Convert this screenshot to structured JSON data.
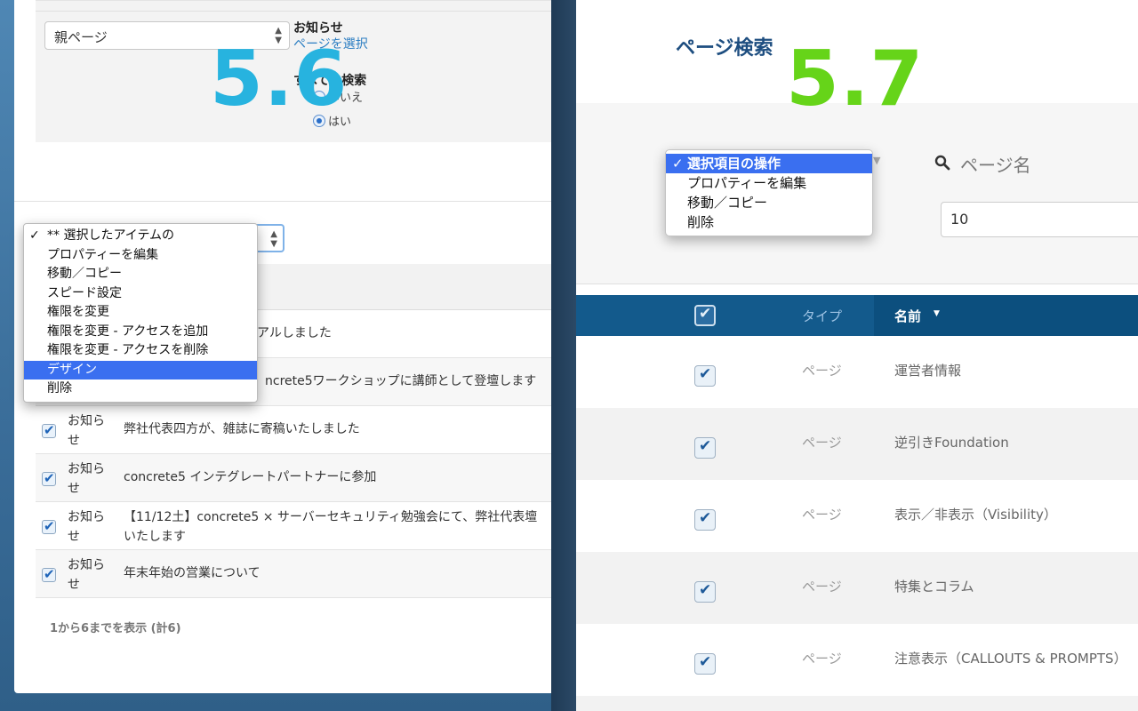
{
  "left": {
    "version_label": "5.6",
    "parent_select": {
      "value": "親ページ"
    },
    "notice_filter": {
      "title": "お知らせ",
      "select_link": "ページを選択"
    },
    "search_all": {
      "label": "すべてを検索",
      "option_no": "いいえ",
      "option_yes": "はい"
    },
    "bulk_menu": {
      "items": [
        {
          "label": "** 選択したアイテムの",
          "checked": true,
          "active": false
        },
        {
          "label": "プロパティーを編集",
          "checked": false,
          "active": false
        },
        {
          "label": "移動／コピー",
          "checked": false,
          "active": false
        },
        {
          "label": "スピード設定",
          "checked": false,
          "active": false
        },
        {
          "label": "権限を変更",
          "checked": false,
          "active": false
        },
        {
          "label": "権限を変更 - アクセスを追加",
          "checked": false,
          "active": false
        },
        {
          "label": "権限を変更 - アクセスを削除",
          "checked": false,
          "active": false
        },
        {
          "label": "デザイン",
          "checked": false,
          "active": true
        },
        {
          "label": "削除",
          "checked": false,
          "active": false
        }
      ]
    },
    "rows_partial": [
      {
        "name_tail": "アルしました"
      },
      {
        "name_tail": "ncrete5ワークショップに講師として登壇します"
      }
    ],
    "rows": [
      {
        "type": "お知らせ",
        "name": "弊社代表四方が、雑誌に寄稿いたしました"
      },
      {
        "type": "お知らせ",
        "name": "concrete5 インテグレートパートナーに参加"
      },
      {
        "type": "お知らせ",
        "name": "【11/12土】concrete5 × サーバーセキュリティ勉強会にて、弊社代表壇いたします"
      },
      {
        "type": "お知らせ",
        "name": "年末年始の営業について"
      }
    ],
    "footer": "1から6までを表示 (計6)"
  },
  "right": {
    "version_label": "5.7",
    "title": "ページ検索",
    "bulk_menu": {
      "items": [
        {
          "label": "選択項目の操作",
          "checked": true,
          "active": true
        },
        {
          "label": "プロパティーを編集",
          "checked": false,
          "active": false
        },
        {
          "label": "移動／コピー",
          "checked": false,
          "active": false
        },
        {
          "label": "削除",
          "checked": false,
          "active": false
        }
      ]
    },
    "search_placeholder": "ページ名",
    "count_value": "10",
    "table": {
      "col_type": "タイプ",
      "col_name": "名前",
      "rows": [
        {
          "type": "ページ",
          "name": "運営者情報"
        },
        {
          "type": "ページ",
          "name": "逆引きFoundation"
        },
        {
          "type": "ページ",
          "name": "表示／非表示（Visibility）"
        },
        {
          "type": "ページ",
          "name": "特集とコラム"
        },
        {
          "type": "ページ",
          "name": "注意表示（CALLOUTS & PROMPTS）"
        }
      ]
    }
  },
  "colors": {
    "left_version": "#27b3df",
    "right_version": "#66d419",
    "menu_highlight": "#3a6ff0",
    "table_header": "#0c4f7e"
  }
}
